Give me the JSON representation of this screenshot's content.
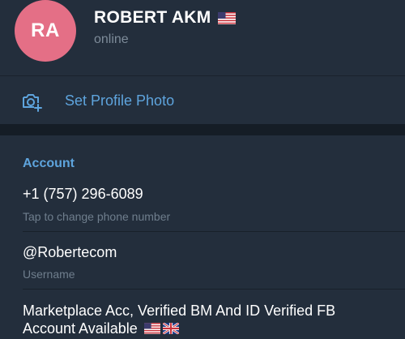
{
  "profile": {
    "initials": "RA",
    "name": "ROBERT AKM",
    "status": "online",
    "flag_icon": "us-flag-icon"
  },
  "photo_action": {
    "label": "Set Profile Photo",
    "icon": "camera-add-icon"
  },
  "account": {
    "title": "Account",
    "phone": "+1 (757) 296-6089",
    "phone_hint": "Tap to change phone number",
    "username": "@Robertecom",
    "username_label": "Username",
    "bio_line1": "Marketplace Acc, Verified BM And ID Verified FB",
    "bio_line2": "Account Available",
    "bio_flags": [
      "us-flag-icon",
      "uk-flag-icon"
    ]
  },
  "colors": {
    "background": "#1d2733",
    "panel": "#232e3c",
    "accent": "#5ea4dd",
    "avatar": "#e46f86",
    "muted_text": "#7d8b99"
  }
}
